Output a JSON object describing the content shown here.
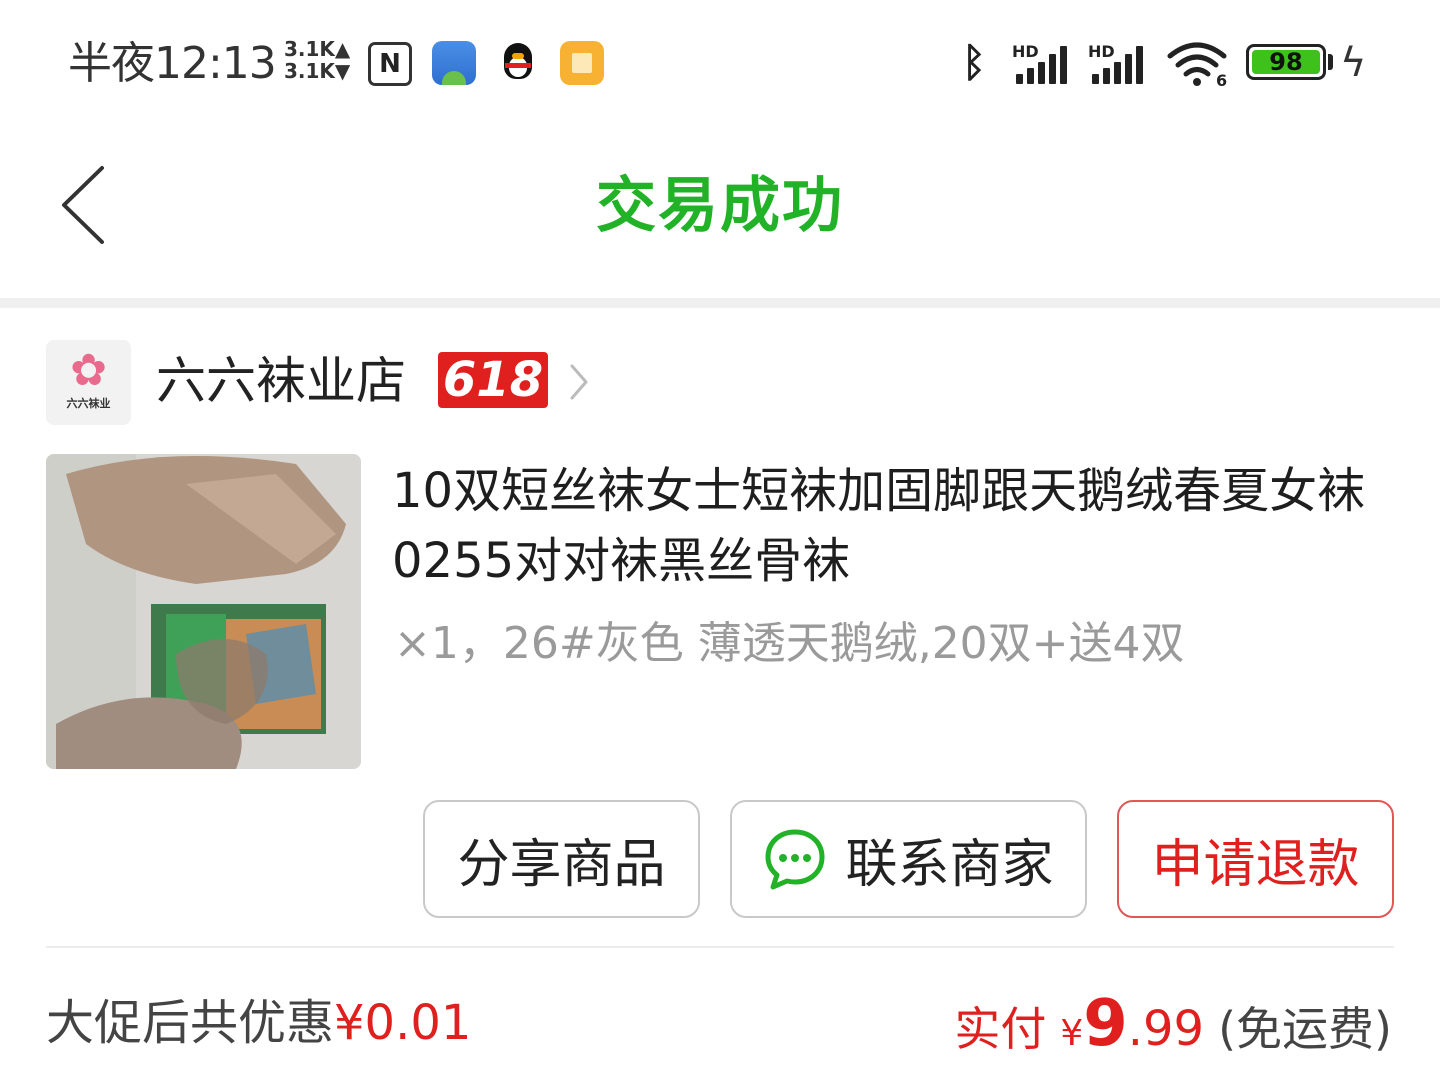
{
  "status_bar": {
    "time": "半夜12:13",
    "net_up": "3.1K▲",
    "net_down": "3.1K▼",
    "nfc_symbol": "N",
    "signal_label": "HD",
    "wifi_badge": "6",
    "battery_level": "98",
    "icons": [
      "nfc-icon",
      "android-app-icon",
      "qq-icon",
      "notes-icon",
      "bluetooth-icon",
      "signal-icon",
      "wifi-icon",
      "battery-icon",
      "charging-icon"
    ]
  },
  "header": {
    "title": "交易成功",
    "title_color": "#22b227"
  },
  "shop": {
    "logo_text": "六六袜业",
    "name": "六六袜业店",
    "badge": "618",
    "badge_color": "#e0201e"
  },
  "product": {
    "title": "10双短丝袜女士短袜加固脚跟天鹅绒春夏女袜0255对对袜黑丝骨袜",
    "spec": "×1，26#灰色 薄透天鹅绒,20双+送4双"
  },
  "actions": {
    "share": "分享商品",
    "contact": "联系商家",
    "refund": "申请退款",
    "accent_color": "#e0201e",
    "chat_icon_color": "#22b227"
  },
  "summary": {
    "discount_label": "大促后共优惠",
    "discount_amount": "¥0.01",
    "paid_label": "实付",
    "currency": "¥",
    "price_int": "9",
    "price_dec": ".99",
    "shipping": "(免运费)"
  }
}
